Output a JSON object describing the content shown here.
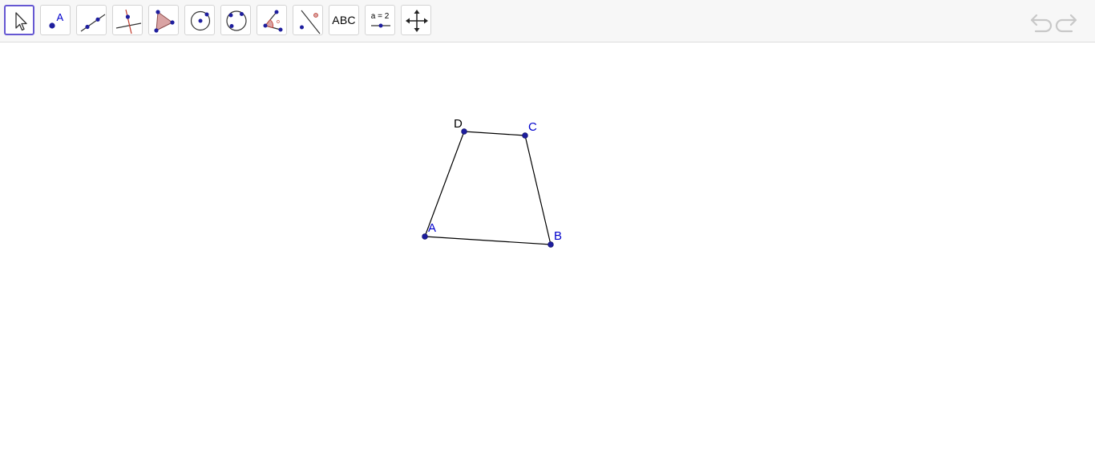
{
  "toolbar": {
    "tools": [
      {
        "name": "Move",
        "icon": "move-cursor-icon",
        "selected": true
      },
      {
        "name": "Point",
        "icon": "point-icon",
        "label": "A"
      },
      {
        "name": "Line",
        "icon": "line-icon"
      },
      {
        "name": "Perpendicular Line",
        "icon": "perpendicular-line-icon"
      },
      {
        "name": "Polygon",
        "icon": "polygon-icon"
      },
      {
        "name": "Circle with Center through Point",
        "icon": "circle-icon"
      },
      {
        "name": "Circle through 3 Points",
        "icon": "circle-three-points-icon"
      },
      {
        "name": "Angle",
        "icon": "angle-icon"
      },
      {
        "name": "Reflect about Line",
        "icon": "reflect-icon"
      },
      {
        "name": "Text",
        "icon": "text-icon",
        "label": "ABC"
      },
      {
        "name": "Slider",
        "icon": "slider-icon",
        "label": "a = 2"
      },
      {
        "name": "Move Graphics View",
        "icon": "move-graphics-view-icon"
      }
    ],
    "undo": {
      "icon": "undo-icon"
    },
    "redo": {
      "icon": "redo-icon"
    }
  },
  "graphics": {
    "points": [
      {
        "label": "A",
        "color": "#0000cc"
      },
      {
        "label": "B",
        "color": "#0000cc"
      },
      {
        "label": "C",
        "color": "#0000cc"
      },
      {
        "label": "D",
        "color": "#000000"
      }
    ],
    "polygon": {
      "vertices": [
        "A",
        "B",
        "C",
        "D"
      ],
      "stroke": "#000000"
    }
  },
  "colors": {
    "accent": "#6557d2",
    "point_fill": "#1e1e9e",
    "point_label_free": "#0000cc",
    "point_label_dependent": "#000000",
    "tool_icon_red": "#c0392b",
    "polygon_fill_icon": "#d9a3a3"
  }
}
